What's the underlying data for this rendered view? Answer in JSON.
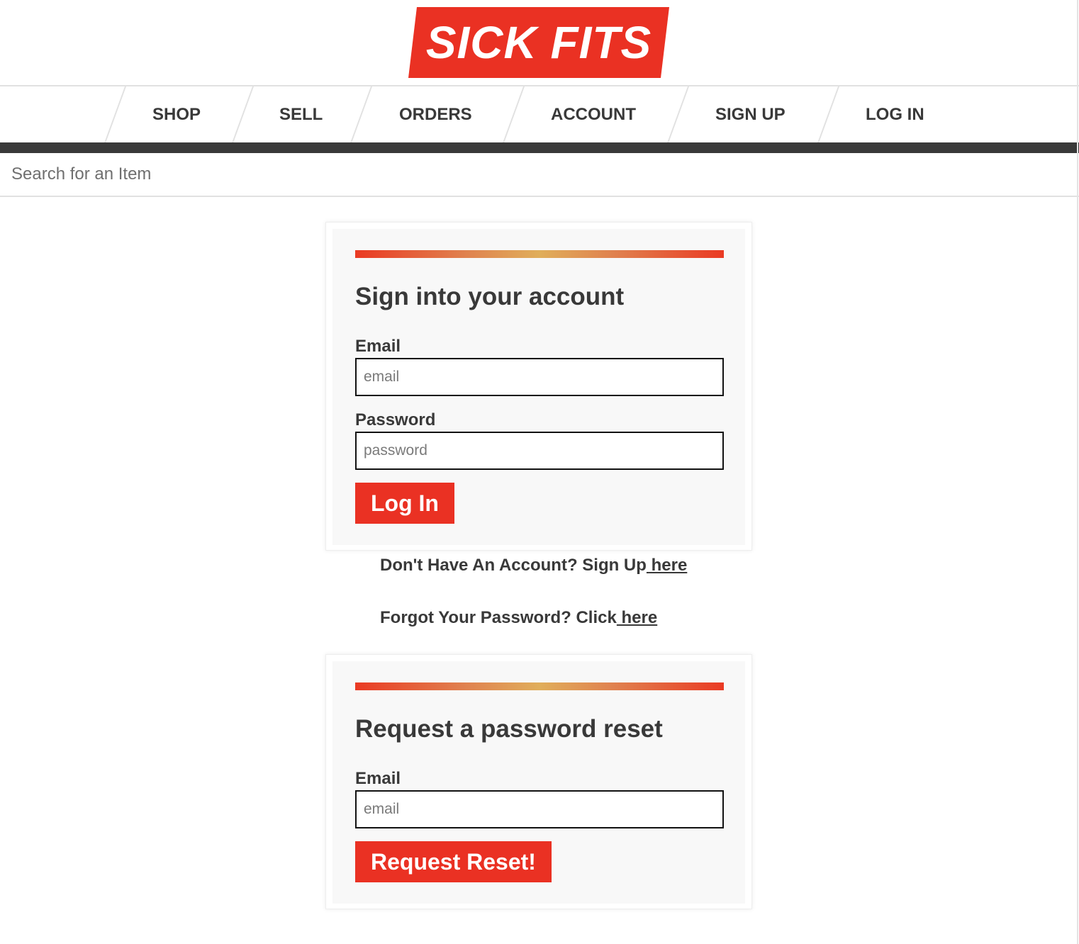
{
  "brand": {
    "logo_text": "SICK FITS",
    "logo_color": "#ea3123"
  },
  "nav": {
    "items": [
      {
        "label": "SHOP"
      },
      {
        "label": "SELL"
      },
      {
        "label": "ORDERS"
      },
      {
        "label": "ACCOUNT"
      },
      {
        "label": "SIGN UP"
      },
      {
        "label": "LOG IN"
      }
    ]
  },
  "search": {
    "placeholder": "Search for an Item"
  },
  "signin": {
    "title": "Sign into your account",
    "email_label": "Email",
    "email_placeholder": "email",
    "password_label": "Password",
    "password_placeholder": "password",
    "submit_label": "Log In"
  },
  "links": {
    "signup_text": "Don't Have An Account? Sign Up",
    "signup_link": " here",
    "forgot_text": "Forgot Your Password? Click",
    "forgot_link": " here"
  },
  "reset": {
    "title": "Request a password reset",
    "email_label": "Email",
    "email_placeholder": "email",
    "submit_label": "Request Reset!"
  },
  "colors": {
    "accent_red": "#ea3123",
    "text_dark": "#393939",
    "gradient": [
      "#ea3a23",
      "#e0ae5a",
      "#ea3a23"
    ]
  }
}
